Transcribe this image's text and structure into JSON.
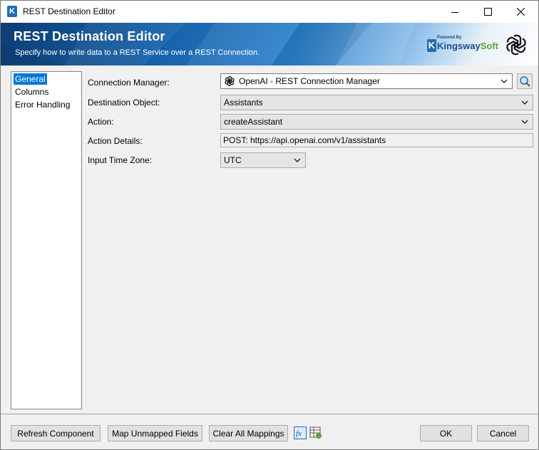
{
  "window": {
    "title": "REST Destination Editor",
    "icon": "kingswaysoft-k-icon"
  },
  "banner": {
    "title": "REST Destination Editor",
    "subtitle": "Specify how to write data to a REST Service over a REST Connection.",
    "powered_by": "Powered By",
    "brand_main": "Kingsway",
    "brand_accent": "Soft",
    "brand_k": "K"
  },
  "nav": {
    "items": [
      {
        "label": "General",
        "selected": true
      },
      {
        "label": "Columns",
        "selected": false
      },
      {
        "label": "Error Handling",
        "selected": false
      }
    ]
  },
  "form": {
    "connection_manager": {
      "label": "Connection Manager:",
      "value": "OpenAI - REST Connection Manager"
    },
    "destination_object": {
      "label": "Destination Object:",
      "value": "Assistants"
    },
    "action": {
      "label": "Action:",
      "value": "createAssistant"
    },
    "action_details": {
      "label": "Action Details:",
      "value": "POST: https://api.openai.com/v1/assistants"
    },
    "input_time_zone": {
      "label": "Input Time Zone:",
      "value": "UTC"
    }
  },
  "footer": {
    "refresh": "Refresh Component",
    "map_unmapped": "Map Unmapped Fields",
    "clear_mappings": "Clear All Mappings",
    "ok": "OK",
    "cancel": "Cancel"
  },
  "colors": {
    "accent": "#0078d7",
    "banner_dark": "#0d3d72",
    "brand_blue": "#1b4f8a",
    "brand_green": "#5aa23a"
  }
}
